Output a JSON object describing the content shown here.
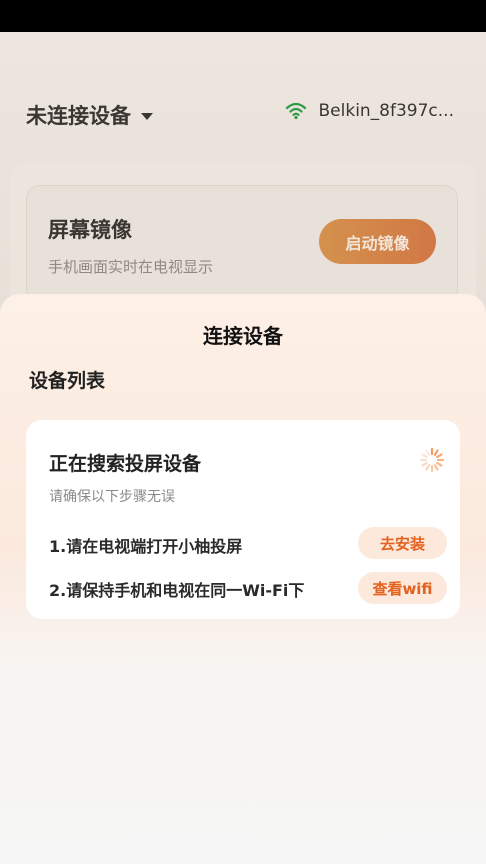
{
  "background": {
    "device_selector": "未连接设备",
    "wifi_name": "Belkin_8f397c...",
    "mirror_card": {
      "title": "屏幕镜像",
      "subtitle": "手机画面实时在电视显示",
      "button": "启动镜像"
    }
  },
  "sheet": {
    "title": "连接设备",
    "list_heading": "设备列表",
    "searching_title": "正在搜索投屏设备",
    "searching_subtitle": "请确保以下步骤无误",
    "steps": [
      {
        "text": "1.请在电视端打开小柚投屏",
        "action": "去安装"
      },
      {
        "text": "2.请保持手机和电视在同一Wi-Fi下",
        "action": "查看wifi"
      }
    ]
  },
  "colors": {
    "accent": "#e4621f",
    "pill_bg": "#fde9dc",
    "wifi_icon": "#2e9a4a"
  },
  "icons": {
    "wifi": "wifi-icon",
    "caret": "caret-down-icon",
    "spinner": "loading-spinner-icon"
  }
}
